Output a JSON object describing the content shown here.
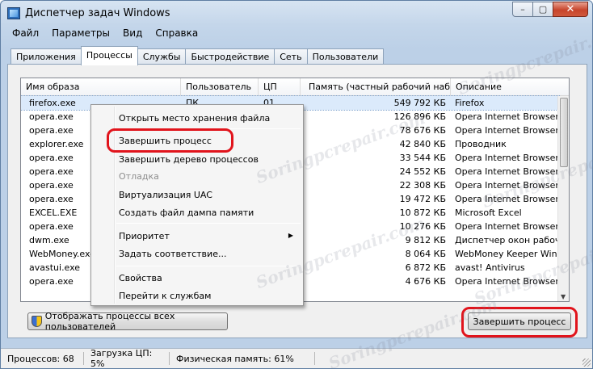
{
  "window": {
    "title": "Диспетчер задач Windows"
  },
  "caption": {
    "minimize": "–",
    "maximize": "▢",
    "close": "✕"
  },
  "menu": [
    "Файл",
    "Параметры",
    "Вид",
    "Справка"
  ],
  "tabs": [
    "Приложения",
    "Процессы",
    "Службы",
    "Быстродействие",
    "Сеть",
    "Пользователи"
  ],
  "active_tab": "Процессы",
  "columns": [
    "Имя образа",
    "Пользователь",
    "ЦП",
    "Память (частный рабочий набор)",
    "Описание"
  ],
  "rows": [
    {
      "name": "firefox.exe",
      "user": "ПК",
      "cpu": "01",
      "mem": "549 792 КБ",
      "desc": "Firefox",
      "selected": true
    },
    {
      "name": "opera.exe",
      "user": "",
      "cpu": "",
      "mem": "126 896 КБ",
      "desc": "Opera Internet Browser"
    },
    {
      "name": "opera.exe",
      "user": "",
      "cpu": "",
      "mem": "78 676 КБ",
      "desc": "Opera Internet Browser"
    },
    {
      "name": "explorer.exe",
      "user": "",
      "cpu": "",
      "mem": "42 840 КБ",
      "desc": "Проводник"
    },
    {
      "name": "opera.exe",
      "user": "",
      "cpu": "",
      "mem": "33 544 КБ",
      "desc": "Opera Internet Browser"
    },
    {
      "name": "opera.exe",
      "user": "",
      "cpu": "",
      "mem": "24 552 КБ",
      "desc": "Opera Internet Browser"
    },
    {
      "name": "opera.exe",
      "user": "",
      "cpu": "",
      "mem": "22 308 КБ",
      "desc": "Opera Internet Browser"
    },
    {
      "name": "opera.exe",
      "user": "",
      "cpu": "",
      "mem": "19 472 КБ",
      "desc": "Opera Internet Browser"
    },
    {
      "name": "EXCEL.EXE",
      "user": "",
      "cpu": "",
      "mem": "10 872 КБ",
      "desc": "Microsoft Excel"
    },
    {
      "name": "opera.exe",
      "user": "",
      "cpu": "",
      "mem": "10 276 КБ",
      "desc": "Opera Internet Browser"
    },
    {
      "name": "dwm.exe",
      "user": "",
      "cpu": "",
      "mem": "9 812 КБ",
      "desc": "Диспетчер окон рабочего"
    },
    {
      "name": "WebMoney.exe",
      "user": "",
      "cpu": "",
      "mem": "8 064 КБ",
      "desc": "WebMoney Keeper WinPr"
    },
    {
      "name": "avastui.exe",
      "user": "",
      "cpu": "",
      "mem": "6 872 КБ",
      "desc": "avast! Antivirus"
    },
    {
      "name": "opera.exe",
      "user": "",
      "cpu": "",
      "mem": "4 676 КБ",
      "desc": "Opera Internet Browser"
    }
  ],
  "context_menu": {
    "open_location": "Открыть место хранения файла",
    "end_process": "Завершить процесс",
    "end_tree": "Завершить дерево процессов",
    "debug": "Отладка",
    "uac": "Виртуализация UAC",
    "dump": "Создать файл дампа памяти",
    "priority": "Приоритет",
    "affinity": "Задать соответствие...",
    "properties": "Свойства",
    "goto_services": "Перейти к службам"
  },
  "buttons": {
    "show_all": "Отображать процессы всех пользователей",
    "end_process": "Завершить процесс"
  },
  "status": {
    "processes": "Процессов: 68",
    "cpu": "Загрузка ЦП: 5%",
    "memory": "Физическая память: 61%"
  },
  "watermark": "Soringpcrepair.com",
  "colors": {
    "highlight_ring": "#e1141c",
    "selected_row": "#dbeafb"
  }
}
